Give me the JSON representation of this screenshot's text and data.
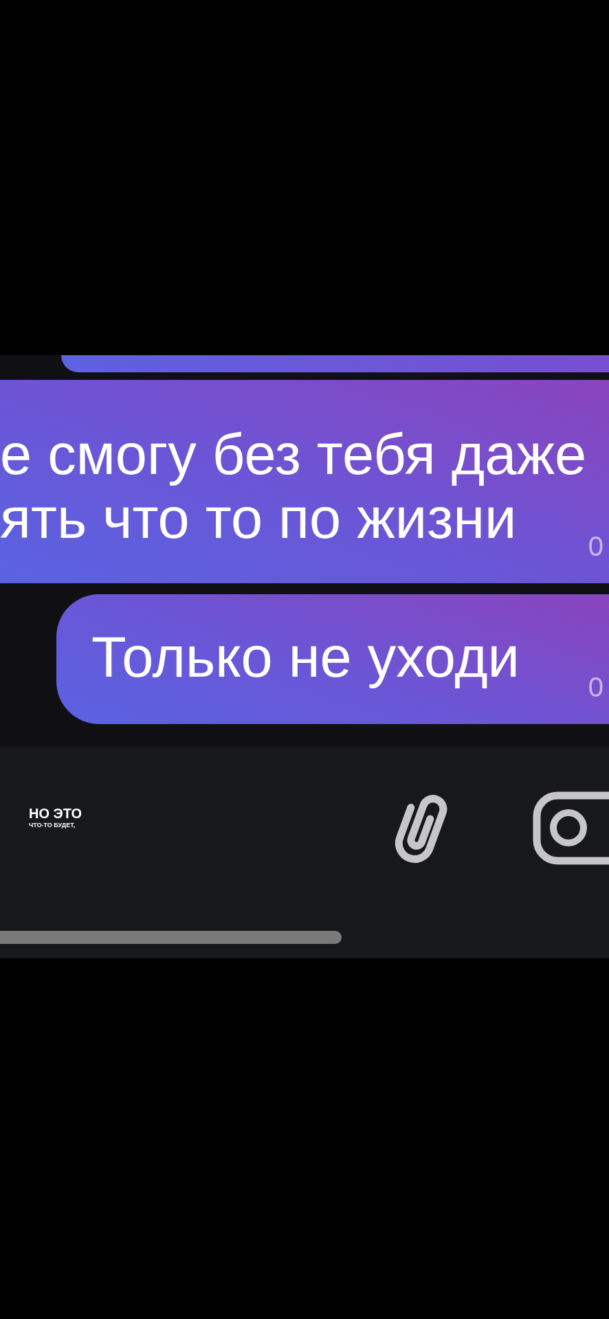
{
  "chat": {
    "messages": [
      {
        "kind": "edge"
      },
      {
        "kind": "overflow",
        "lines": [
          "е смогу без тебя даже",
          "ять что то по жизни"
        ],
        "time": "0"
      },
      {
        "kind": "bubble",
        "lines": [
          "Только не уходи"
        ],
        "time": "0"
      }
    ]
  },
  "composer": {
    "caption": [
      {
        "kind": "large",
        "text": "НО ЭТО"
      },
      {
        "kind": "small",
        "text": "ЧТО-ТО БУДЕТ,"
      }
    ]
  }
}
